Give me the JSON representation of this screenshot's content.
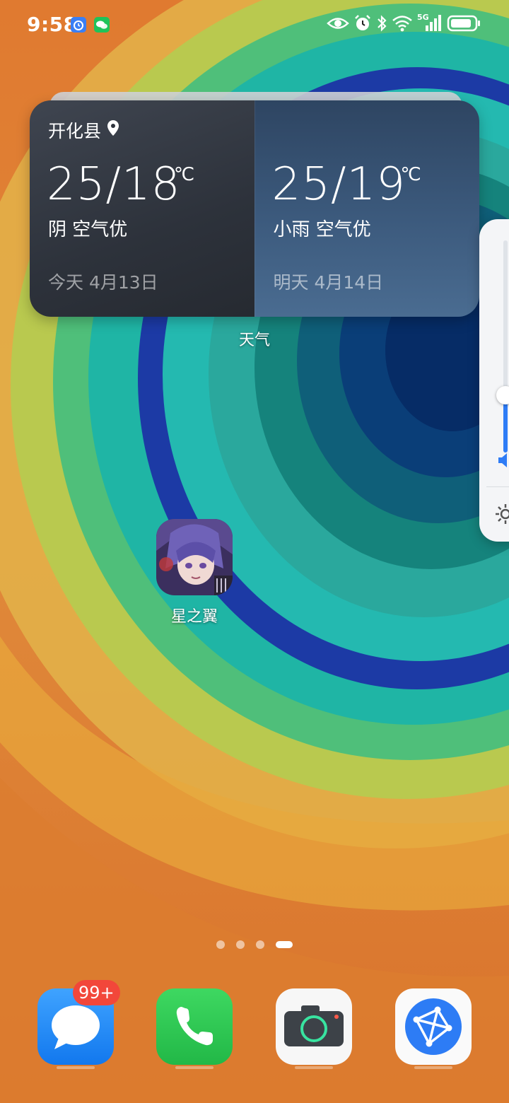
{
  "status_bar": {
    "time": "9:58",
    "network_label": "5G",
    "left_icons": [
      "clock-app-icon",
      "wechat-icon"
    ],
    "right_icons": [
      "eye-icon",
      "alarm-icon",
      "bluetooth-icon",
      "wifi-icon",
      "signal-5g-icon",
      "battery-icon"
    ]
  },
  "weather_widget": {
    "today": {
      "location": "开化县",
      "temperature": "25/18",
      "unit": "℃",
      "condition": "阴  空气优",
      "date": "今天  4月13日"
    },
    "tomorrow": {
      "temperature": "25/19",
      "unit": "℃",
      "condition": "小雨  空气优",
      "date": "明天  4月14日"
    },
    "label": "天气"
  },
  "volume_panel": {
    "level": 0.27,
    "icons": [
      "speaker-icon",
      "gear-icon"
    ]
  },
  "home_apps": [
    {
      "label": "星之翼",
      "icon": "xingzhiyi-game-icon"
    }
  ],
  "page_indicator": {
    "pages": 4,
    "current": 4
  },
  "dock": {
    "apps": [
      {
        "icon": "messages-icon",
        "badge": "99+"
      },
      {
        "icon": "phone-icon"
      },
      {
        "icon": "camera-icon"
      },
      {
        "icon": "browser-icon"
      }
    ]
  },
  "colors": {
    "accent_blue": "#2e7cf6",
    "badge_red": "#f2473a",
    "phone_green": "#2fc94e",
    "messages_blue": "#1e8ef5"
  }
}
